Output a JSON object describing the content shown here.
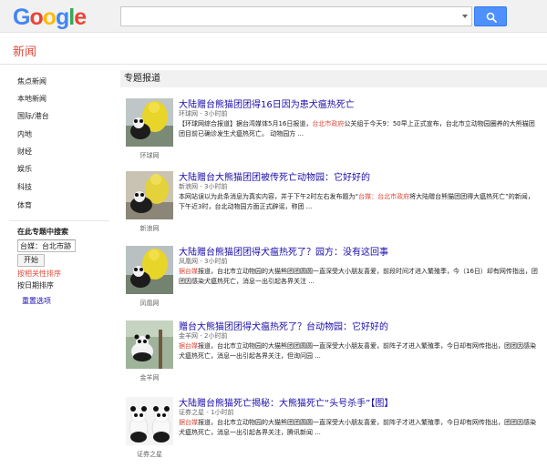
{
  "header": {
    "logo": [
      "G",
      "o",
      "o",
      "g",
      "l",
      "e"
    ],
    "search_value": "",
    "search_icon": "search-icon"
  },
  "section_title": "新闻",
  "sidebar": {
    "items": [
      "焦点新闻",
      "本地新闻",
      "国际/港台",
      "内地",
      "财经",
      "娱乐",
      "科技",
      "体育"
    ],
    "topic_search_label": "在此专题中搜索",
    "topic_search_value": "台媒：台北市跡",
    "go_button": "开始",
    "sort_relevance": "按相关性排序",
    "sort_date": "按日期排序",
    "advanced": "重置选项"
  },
  "main": {
    "header": "专题报道",
    "articles": [
      {
        "title": "大陆赠台熊猫团团得16日因为患犬瘟热死亡",
        "source": "环球网",
        "time": "3小时前",
        "snippet_pre": "【环球网综合报道】据台湾媒体5月16日报道，",
        "snippet_hl": "台北市政府",
        "snippet_post": "公关组于今天9：50早上正式宣布，台北市立动物园圈养的大熊猫团团目前已确诊发生犬瘟热死亡。 动物园方 ...",
        "thumb_label": "环球网"
      },
      {
        "title": "大陆赠台大熊猫团团被传死亡动物园：它好好的",
        "source": "新浪网",
        "time": "3小时前",
        "snippet_pre": "本网站误以为此条消息为真实内容，并于下午2时左右发布题为“",
        "snippet_hl": "台媒：台北市政府",
        "snippet_post": "将大陆赠台熊猫团团得大瘟热死亡”的新闻，下午近3时，台北动物园方面正式辟谣，称团 ...",
        "thumb_label": "新浪网"
      },
      {
        "title": "大陆赠台熊猫团团得犬瘟热死了？园方：没有这回事",
        "source": "凤凰网",
        "time": "3小时前",
        "snippet_pre": "",
        "snippet_hl": "据台媒",
        "snippet_post": "报道，台北市立动物园的大猫熊团团圆圆一直深受大小朋友喜爱，前段时间才进入繁殖季，今（16日）却有网传指出，团团因感染犬瘟热死亡，消息一出引起各界关注 ...",
        "thumb_label": "凤凰网"
      },
      {
        "title": "赠台大熊猫团团得犬瘟热死了？台动物园：它好好的",
        "source": "金羊网",
        "time": "2小时前",
        "snippet_pre": "",
        "snippet_hl": "据台媒",
        "snippet_post": "报道，台北市立动物园的大猫熊团团圆圆一直深受大小朋友喜爱，前阵子才进入繁殖季，今日却有网传指出，团团因感染犬瘟热死亡，消息一出引起各界关注，但询问园 ...",
        "thumb_label": "金羊网"
      },
      {
        "title": "大陆赠台熊猫死亡揭秘：大熊猫死亡“头号杀手”【图】",
        "source": "证券之星",
        "time": "1小时前",
        "snippet_pre": "",
        "snippet_hl": "据台媒",
        "snippet_post": "报道，台北市立动物园的大猫熊团团圆圆一直深受大小朋友喜爱，前阵子才进入繁殖季，今日却有网传指出，团团因感染犬瘟热死亡，消息一出引起各界关注，腾讯新闻 ...",
        "thumb_label": "证券之星"
      }
    ]
  },
  "colors": {
    "accent_red": "#dd4b39",
    "link_blue": "#1a0dab",
    "search_blue": "#4d90fe"
  }
}
